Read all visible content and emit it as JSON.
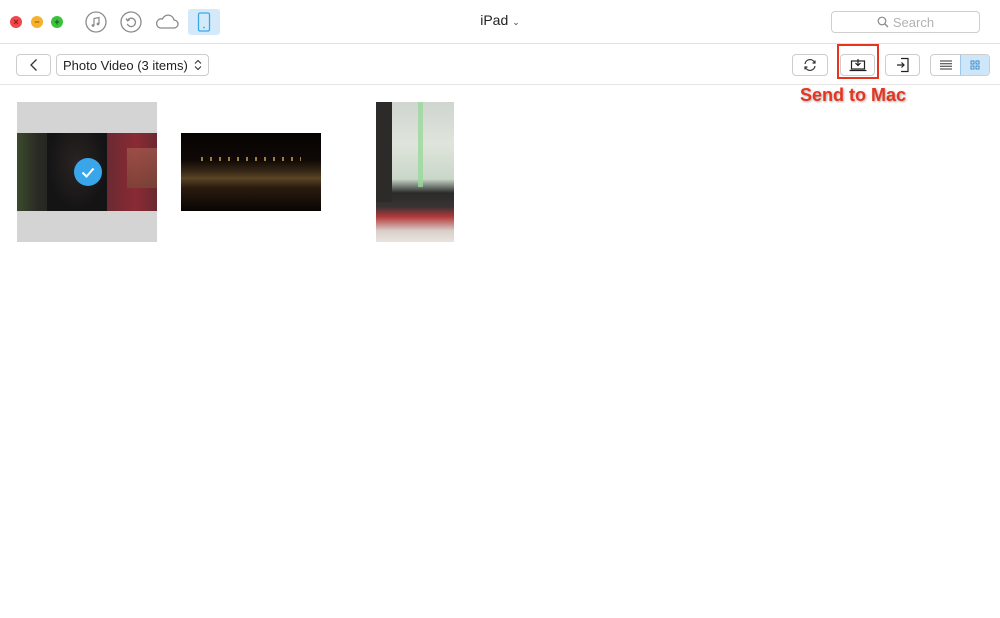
{
  "window": {
    "title": "iPad",
    "title_chevron": "⌄",
    "traffic_lights": {
      "close": "×",
      "minimize": "−",
      "maximize": "+"
    }
  },
  "nav_icons": [
    {
      "name": "music-icon",
      "active": false
    },
    {
      "name": "backup-restore-icon",
      "active": false
    },
    {
      "name": "icloud-icon",
      "active": false
    },
    {
      "name": "ipad-device-icon",
      "active": true
    }
  ],
  "search": {
    "placeholder": "Search"
  },
  "toolbar": {
    "back_label": "<",
    "category_select": "Photo Video (3 items)",
    "buttons": [
      "refresh",
      "send-to-mac",
      "import-to-device",
      "list-view",
      "grid-view"
    ],
    "active_view": "grid"
  },
  "annotation": {
    "label": "Send to Mac",
    "color": "#e8331e"
  },
  "items": [
    {
      "kind": "video",
      "orientation": "landscape",
      "selected": true,
      "description": "people at night market"
    },
    {
      "kind": "video",
      "orientation": "landscape",
      "selected": false,
      "description": "night street scene"
    },
    {
      "kind": "video",
      "orientation": "portrait",
      "selected": false,
      "description": "blurry monitor"
    }
  ],
  "colors": {
    "accent": "#3aa6ea",
    "active_bg": "#d4eafb",
    "highlight": "#e8331e"
  }
}
